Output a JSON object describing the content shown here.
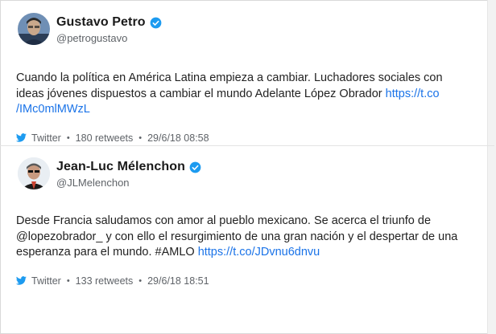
{
  "tweets": [
    {
      "name": "Gustavo Petro",
      "handle": "@petrogustavo",
      "text": "Cuando la política en América Latina empieza a cambiar. Luchadores sociales con ideas jóvenes dispuestos a cambiar el mundo Adelante López Obrador ",
      "link": "https://t.co /IMc0mlMWzL",
      "source": "Twitter",
      "retweets": "180 retweets",
      "datetime": "29/6/18 08:58"
    },
    {
      "name": "Jean-Luc Mélenchon",
      "handle": "@JLMelenchon",
      "text": "Desde Francia saludamos con amor al pueblo mexicano. Se acerca el triunfo de @lopezobrador_ y con ello el resurgimiento de una gran nación y el despertar de una esperanza para el mundo. #AMLO ",
      "link": "https://t.co/JDvnu6dnvu",
      "source": "Twitter",
      "retweets": "133 retweets",
      "datetime": "29/6/18 18:51"
    }
  ],
  "colors": {
    "link": "#1a73e8",
    "verified": "#1d9bf0",
    "twitter_bird": "#1d9bf0",
    "meta_text": "#5f6368"
  },
  "icons": {
    "verified": "verified-badge-icon",
    "source": "twitter-bird-icon"
  }
}
